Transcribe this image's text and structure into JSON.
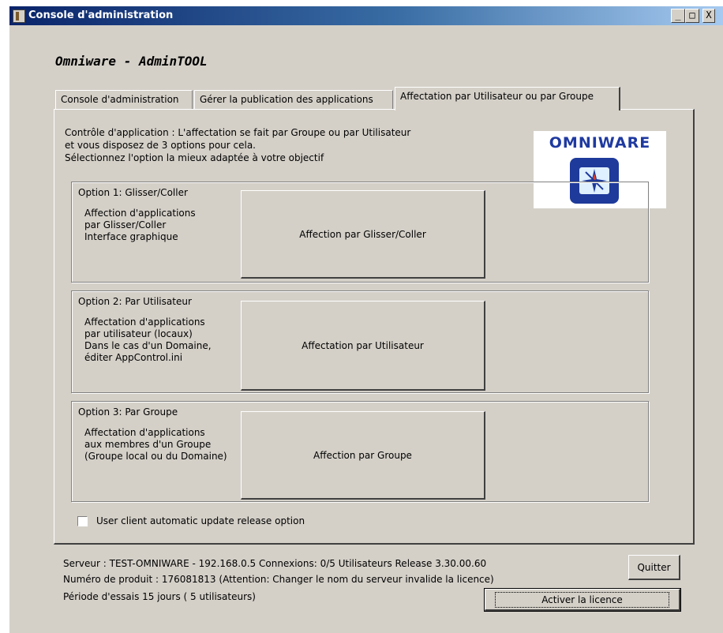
{
  "window": {
    "title": "Console d'administration",
    "controls": {
      "minimize": "_",
      "maximize": "□",
      "close": "X"
    }
  },
  "app_heading": "Omniware - AdminTOOL",
  "tabs": [
    {
      "label": "Console d'administration",
      "active": false
    },
    {
      "label": "Gérer la publication des applications",
      "active": false
    },
    {
      "label": "Affectation par Utilisateur ou par Groupe",
      "active": true
    }
  ],
  "intro": {
    "line1": "Contrôle d'application : L'affectation se fait par Groupe ou par Utilisateur",
    "line2": "et vous disposez de 3 options pour cela.",
    "line3": "Sélectionnez l'option la mieux adaptée à votre objectif"
  },
  "logo": {
    "text": "OMNIWARE",
    "icon": "compass-icon"
  },
  "options": [
    {
      "title": "Option 1: Glisser/Coller",
      "desc": [
        "Affection d'applications",
        "par Glisser/Coller",
        "Interface graphique"
      ],
      "button": "Affection par Glisser/Coller"
    },
    {
      "title": "Option 2: Par Utilisateur",
      "desc": [
        "Affectation d'applications",
        "par utilisateur (locaux)",
        "Dans le cas d'un Domaine,",
        "éditer AppControl.ini"
      ],
      "button": "Affectation par Utilisateur"
    },
    {
      "title": "Option 3: Par Groupe",
      "desc": [
        "Affectation d'applications",
        "aux membres d'un Groupe",
        "(Groupe local ou du Domaine)"
      ],
      "button": "Affection par Groupe"
    }
  ],
  "checkbox": {
    "label": "User client automatic update release option",
    "checked": false
  },
  "status": {
    "line1": "Serveur : TEST-OMNIWARE  - 192.168.0.5  Connexions: 0/5  Utilisateurs   Release 3.30.00.60",
    "line2": "Numéro de produit : 176081813  (Attention: Changer le nom du serveur invalide la licence)",
    "line3": "Période d'essais 15 jours ( 5 utilisateurs)"
  },
  "buttons": {
    "quit": "Quitter",
    "activate": "Activer la licence"
  }
}
